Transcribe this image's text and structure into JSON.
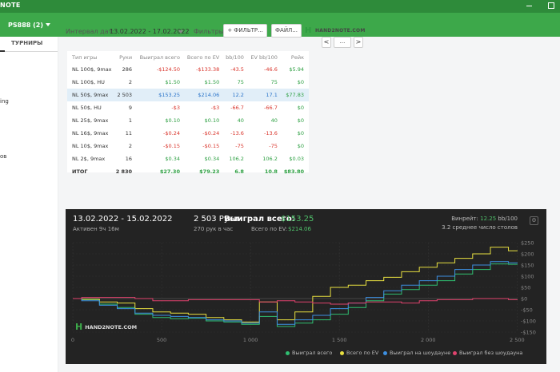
{
  "window": {
    "title": "NOTE"
  },
  "room": {
    "label": "PS888 (2)"
  },
  "sidebar": {
    "tab": "ТУРНИРЫ",
    "fragments": [
      "ing",
      "ов"
    ]
  },
  "toolbar": {
    "interval_label": "Интервал дат:",
    "interval_value": "13.02.2022 - 17.02.2022",
    "filters_label": "Фильтры:",
    "filter_button": "+ ФИЛЬТР...",
    "file_button": "ФАЙЛ...",
    "logo": "HAND2NOTE.COM",
    "prev": "<",
    "more": "...",
    "next": ">"
  },
  "table": {
    "headers": [
      "Тип игры",
      "Руки",
      "Выиграл всего",
      "Всего по EV",
      "bb/100",
      "EV bb/100",
      "Рейк"
    ],
    "rows": [
      [
        "NL 100$, 9max",
        "286",
        "-$124.50",
        "-$133.38",
        "-43.5",
        "-46.6",
        "$5.94"
      ],
      [
        "NL 100$, HU",
        "2",
        "$1.50",
        "$1.50",
        "75",
        "75",
        "$0"
      ],
      [
        "NL 50$, 9max",
        "2 503",
        "$153.25",
        "$214.06",
        "12.2",
        "17.1",
        "$77.83"
      ],
      [
        "NL 50$, HU",
        "9",
        "-$3",
        "-$3",
        "-66.7",
        "-66.7",
        "$0"
      ],
      [
        "NL 25$, 9max",
        "1",
        "$0.10",
        "$0.10",
        "40",
        "40",
        "$0"
      ],
      [
        "NL 16$, 9max",
        "11",
        "-$0.24",
        "-$0.24",
        "-13.6",
        "-13.6",
        "$0"
      ],
      [
        "NL 10$, 9max",
        "2",
        "-$0.15",
        "-$0.15",
        "-75",
        "-75",
        "$0"
      ],
      [
        "NL 2$, 9max",
        "16",
        "$0.34",
        "$0.34",
        "106.2",
        "106.2",
        "$0.03"
      ]
    ],
    "total": [
      "ИТОГ",
      "2 830",
      "$27.30",
      "$79.23",
      "6.8",
      "10.8",
      "$83.80"
    ]
  },
  "graph": {
    "date_range": "13.02.2022 - 15.02.2022",
    "active": "Активен 9ч 16м",
    "hands": "2 503 Руки",
    "per_hour": "270 рук в час",
    "won_label": "Выиграл всего:",
    "won_value": "$153.25",
    "ev_label": "Всего по EV:",
    "ev_value": "$214.06",
    "winrate_label": "Винрейт:",
    "winrate_value": "12.25",
    "winrate_unit": "bb/100",
    "tables": "3.2 среднее число столов",
    "logo": "HAND2NOTE.COM",
    "gear": "⚙",
    "y_ticks": [
      "$250",
      "$200",
      "$150",
      "$100",
      "$50",
      "$0",
      "-$50",
      "-$100",
      "-$150"
    ],
    "x_ticks": [
      "0",
      "500",
      "1 000",
      "1 500",
      "2 000",
      "2 500"
    ],
    "legend": [
      {
        "label": "Выиграл всего",
        "color": "#2fbf71"
      },
      {
        "label": "Всего по EV",
        "color": "#e8e040"
      },
      {
        "label": "Выиграл на шоудауне",
        "color": "#3d8fe0"
      },
      {
        "label": "Выиграл без шоудауна",
        "color": "#e0436e"
      }
    ]
  },
  "chart_data": {
    "type": "line",
    "xlabel": "",
    "ylabel": "",
    "xlim": [
      0,
      2503
    ],
    "ylim": [
      -150,
      250
    ],
    "series": [
      {
        "name": "Выиграл всего",
        "color": "#2fbf71",
        "x": [
          0,
          100,
          200,
          300,
          400,
          500,
          600,
          700,
          800,
          900,
          1000,
          1100,
          1200,
          1300,
          1400,
          1500,
          1600,
          1700,
          1800,
          1900,
          2000,
          2100,
          2200,
          2300,
          2400,
          2503
        ],
        "y": [
          0,
          -5,
          -25,
          -40,
          -70,
          -85,
          -90,
          -88,
          -100,
          -105,
          -115,
          -80,
          -125,
          -110,
          -95,
          -70,
          -40,
          -10,
          20,
          40,
          60,
          80,
          110,
          130,
          155,
          153.25
        ]
      },
      {
        "name": "Всего по EV",
        "color": "#e8e040",
        "x": [
          0,
          100,
          200,
          300,
          400,
          500,
          600,
          700,
          800,
          900,
          1000,
          1100,
          1200,
          1300,
          1400,
          1500,
          1600,
          1700,
          1800,
          1900,
          2000,
          2100,
          2200,
          2300,
          2400,
          2503
        ],
        "y": [
          0,
          -3,
          -15,
          -20,
          -45,
          -60,
          -65,
          -70,
          -85,
          -95,
          -105,
          -15,
          -95,
          -60,
          10,
          50,
          60,
          80,
          95,
          120,
          140,
          160,
          180,
          200,
          230,
          214.06
        ]
      },
      {
        "name": "Выиграл на шоудауне",
        "color": "#3d8fe0",
        "x": [
          0,
          100,
          200,
          300,
          400,
          500,
          600,
          700,
          800,
          900,
          1000,
          1100,
          1200,
          1300,
          1400,
          1500,
          1600,
          1700,
          1800,
          1900,
          2000,
          2100,
          2200,
          2300,
          2400,
          2503
        ],
        "y": [
          0,
          -10,
          -30,
          -45,
          -65,
          -75,
          -80,
          -85,
          -95,
          -100,
          -110,
          -60,
          -115,
          -95,
          -75,
          -45,
          -20,
          5,
          35,
          60,
          80,
          100,
          130,
          150,
          165,
          160
        ]
      },
      {
        "name": "Выиграл без шоудауна",
        "color": "#e0436e",
        "x": [
          0,
          100,
          200,
          300,
          400,
          500,
          600,
          700,
          800,
          900,
          1000,
          1100,
          1200,
          1300,
          1400,
          1500,
          1600,
          1700,
          1800,
          1900,
          2000,
          2100,
          2200,
          2300,
          2400,
          2503
        ],
        "y": [
          0,
          5,
          5,
          5,
          0,
          -10,
          -10,
          -5,
          -5,
          -5,
          -5,
          -15,
          -10,
          -15,
          -20,
          -25,
          -20,
          -15,
          -15,
          -20,
          -10,
          -5,
          -5,
          0,
          0,
          -5
        ]
      }
    ]
  }
}
